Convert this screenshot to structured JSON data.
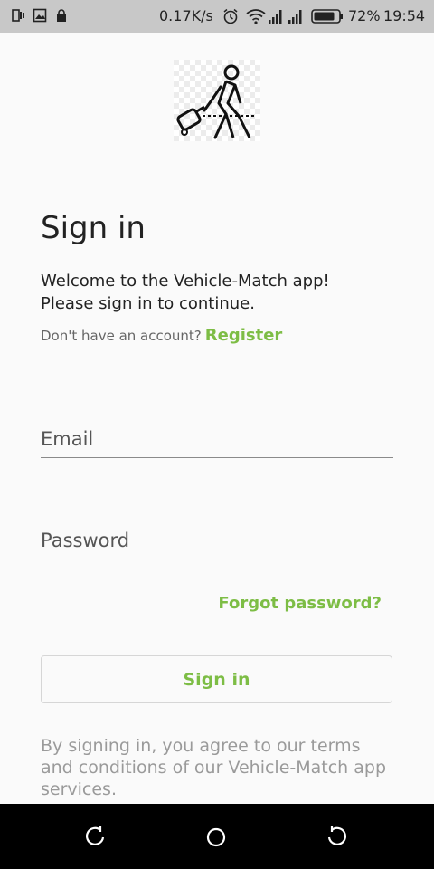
{
  "status_bar": {
    "speed": "0.17K/s",
    "battery_percent": "72%",
    "time": "19:54"
  },
  "page": {
    "title": "Sign in",
    "welcome_line1": "Welcome to the Vehicle-Match app!",
    "welcome_line2": "Please sign in to continue.",
    "no_account_text": "Don't have an account?",
    "register_label": "Register",
    "email_placeholder": "Email",
    "email_value": "",
    "password_placeholder": "Password",
    "password_value": "",
    "forgot_label": "Forgot password?",
    "signin_button_label": "Sign in",
    "terms_text": "By signing in, you agree to our terms and conditions of our Vehicle-Match app services."
  },
  "colors": {
    "accent": "#7dbd45",
    "status_bar_bg": "#c8c8c8",
    "nav_bar_bg": "#000000"
  },
  "icons": {
    "logo": "traveler-with-luggage-icon",
    "nav_back": "nav-back-icon",
    "nav_home": "nav-home-icon",
    "nav_recent": "nav-recent-icon"
  }
}
